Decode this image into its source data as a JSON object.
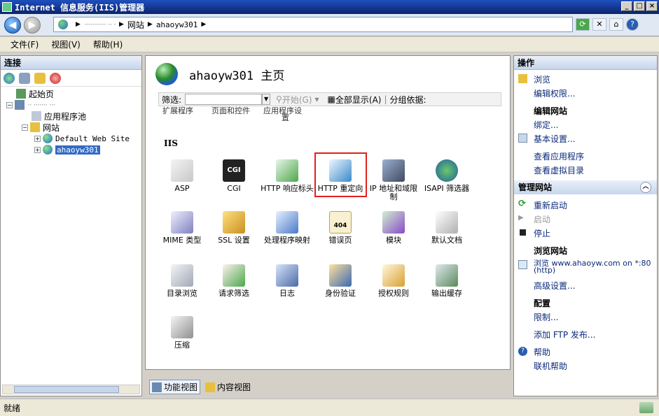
{
  "window": {
    "title": "Internet 信息服务(IIS)管理器"
  },
  "address": {
    "host_blurred": "··········· ·· ·",
    "crumb_sites": "网站",
    "crumb_site": "ahaoyw301"
  },
  "menu": [
    "文件(F)",
    "视图(V)",
    "帮助(H)"
  ],
  "connections": {
    "header": "连接",
    "tree": {
      "start_page": "起始页",
      "server": "·· ······· ···",
      "app_pools": "应用程序池",
      "sites": "网站",
      "default_site": "Default Web Site",
      "selected_site": "ahaoyw301"
    }
  },
  "center": {
    "title": "ahaoyw301 主页",
    "filter_label": "筛选:",
    "start_label": "开始(G)",
    "show_all_label": "全部显示(A)",
    "group_by_label": "分组依据:",
    "cutoff": [
      "扩展程序",
      "页面和控件",
      "应用程序设",
      "置"
    ],
    "section": "IIS",
    "features": [
      {
        "label": "ASP",
        "icon": "asp-icon"
      },
      {
        "label": "CGI",
        "icon": "cgi-icon"
      },
      {
        "label": "HTTP 响应标头",
        "icon": "http-response-headers-icon"
      },
      {
        "label": "HTTP 重定向",
        "icon": "http-redirect-icon"
      },
      {
        "label": "IP 地址和域限制",
        "icon": "ip-domain-restrictions-icon"
      },
      {
        "label": "ISAPI 筛选器",
        "icon": "isapi-filters-icon"
      },
      {
        "label": "MIME 类型",
        "icon": "mime-types-icon"
      },
      {
        "label": "SSL 设置",
        "icon": "ssl-settings-icon"
      },
      {
        "label": "处理程序映射",
        "icon": "handler-mappings-icon"
      },
      {
        "label": "错误页",
        "icon": "error-pages-icon"
      },
      {
        "label": "模块",
        "icon": "modules-icon"
      },
      {
        "label": "默认文档",
        "icon": "default-document-icon"
      },
      {
        "label": "目录浏览",
        "icon": "directory-browsing-icon"
      },
      {
        "label": "请求筛选",
        "icon": "request-filtering-icon"
      },
      {
        "label": "日志",
        "icon": "logging-icon"
      },
      {
        "label": "身份验证",
        "icon": "authentication-icon"
      },
      {
        "label": "授权规则",
        "icon": "authorization-rules-icon"
      },
      {
        "label": "输出缓存",
        "icon": "output-caching-icon"
      },
      {
        "label": "压缩",
        "icon": "compression-icon"
      }
    ],
    "error_page_badge": "404",
    "cgi_badge": "CGI",
    "views": {
      "features": "功能视图",
      "content": "内容视图"
    }
  },
  "actions": {
    "header": "操作",
    "browse": "浏览",
    "edit_permissions": "编辑权限...",
    "edit_site": "编辑网站",
    "bindings": "绑定...",
    "basic_settings": "基本设置...",
    "view_apps": "查看应用程序",
    "view_vdirs": "查看虚拟目录",
    "manage_site": "管理网站",
    "restart": "重新启动",
    "start": "启动",
    "stop": "停止",
    "browse_site": "浏览网站",
    "browse_url": "浏览 www.ahaoyw.com on *:80",
    "browse_url2": "(http)",
    "advanced": "高级设置...",
    "config": "配置",
    "limits": "限制...",
    "add_ftp": "添加 FTP 发布...",
    "help": "帮助",
    "online_help": "联机帮助"
  },
  "status": {
    "text": "就绪"
  }
}
